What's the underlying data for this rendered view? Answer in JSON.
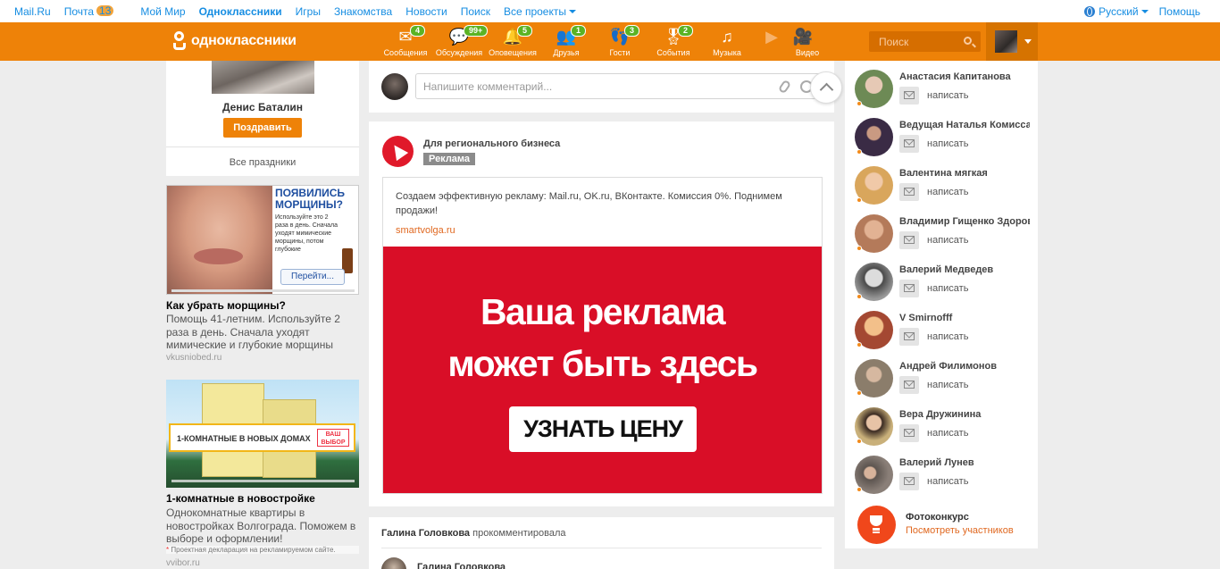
{
  "topbar": {
    "links": [
      "Mail.Ru",
      "Почта",
      "Мой Мир",
      "Одноклассники",
      "Игры",
      "Знакомства",
      "Новости",
      "Поиск",
      "Все проекты"
    ],
    "mail_count": "13",
    "language": "Русский",
    "help": "Помощь"
  },
  "header": {
    "logo": "одноклассники",
    "nav": [
      {
        "label": "Сообщения",
        "count": "4",
        "icon": "envelope-icon"
      },
      {
        "label": "Обсуждения",
        "count": "99+",
        "icon": "chat-bubbles-icon"
      },
      {
        "label": "Оповещения",
        "count": "5",
        "icon": "bell-icon"
      },
      {
        "label": "Друзья",
        "count": "1",
        "icon": "friends-icon"
      },
      {
        "label": "Гости",
        "count": "3",
        "icon": "footprints-icon"
      },
      {
        "label": "События",
        "count": "2",
        "icon": "events-icon"
      },
      {
        "label": "Музыка",
        "count": "",
        "icon": "music-note-icon"
      },
      {
        "label": "Видео",
        "count": "",
        "icon": "video-camera-icon"
      }
    ],
    "search_placeholder": "Поиск"
  },
  "left": {
    "birthday_name": "Денис Баталин",
    "congrats_button": "Поздравить",
    "all_holidays": "Все праздники",
    "ad1": {
      "headline": "ПОЯВИЛИСЬ МОРЩИНЫ?",
      "sub": "Используйте это 2 раза в день. Сначала уходят мимические морщины, потом глубокие",
      "go": "Перейти...",
      "title": "Как убрать морщины?",
      "desc": "Помощь 41-летним. Используйте 2 раза в день. Сначала уходят мимические и глубокие морщины",
      "source": "vkusniobed.ru"
    },
    "ad2": {
      "banner": "1-КОМНАТНЫЕ В НОВЫХ ДОМАХ",
      "brand": "ВАШ ВЫБОР",
      "title": "1-комнатные в новостройке",
      "desc": "Однокомнатные квартиры в новостройках Волгограда. Поможем в выборе и оформлении!",
      "declaration": "Проектная декларация на рекламируемом сайте.",
      "source": "vvibor.ru"
    }
  },
  "center": {
    "comment_placeholder": "Напишите комментарий...",
    "post": {
      "author": "Для регионального бизнеса",
      "label": "Реклама",
      "text": "Создаем эффективную рекламу: Mail.ru, OK.ru, ВКонтакте. Комиссия 0%. Поднимем продажи!",
      "url": "smartvolga.ru",
      "banner_line1": "Ваша реклама",
      "banner_line2": "может быть здесь",
      "banner_cta": "УЗНАТЬ ЦЕНУ"
    },
    "feed": {
      "actor": "Галина Головкова",
      "action": "прокомментировала",
      "name": "Галина Головкова"
    }
  },
  "right": {
    "write_label": "написать",
    "friends": [
      {
        "name": "Анастасия Капитанова",
        "color": "#6d8a55"
      },
      {
        "name": "Ведущая Наталья Комиссарова",
        "color": "#3a2b45"
      },
      {
        "name": "Валентина мягкая",
        "color": "#d9a65c"
      },
      {
        "name": "Владимир Гищенко Здоровье",
        "color": "#b47a5a"
      },
      {
        "name": "Валерий Медведев",
        "color": "#9a9a9a"
      },
      {
        "name": "V Smirnofff",
        "color": "#a44832"
      },
      {
        "name": "Андрей Филимонов",
        "color": "#8b7d6b"
      },
      {
        "name": "Вера Дружинина",
        "color": "#c9b07a"
      },
      {
        "name": "Валерий Лунев",
        "color": "#5d5550"
      }
    ],
    "contest_title": "Фотоконкурс",
    "contest_link": "Посмотреть участников"
  }
}
